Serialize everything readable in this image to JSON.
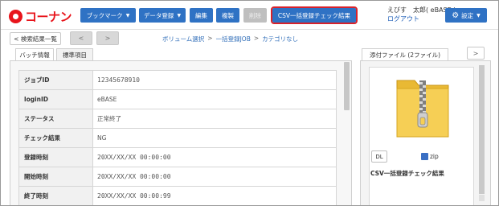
{
  "header": {
    "logo_text": "コーナン",
    "buttons": {
      "bookmark": "ブックマーク",
      "data_register": "データ登録",
      "edit": "編集",
      "copy": "複製",
      "delete": "削除",
      "csv_check": "CSV一括登録チェック結果"
    },
    "user_name": "えびす　太郎( eBASE ) ···",
    "logout": "ログアウト",
    "settings": "設定"
  },
  "subnav": {
    "back_to_results": "< 検索結果一覧",
    "prev": "<",
    "next": ">",
    "breadcrumb": [
      "ボリューム選択",
      "一括登録JOB",
      "カテゴリなし"
    ],
    "separator": ">"
  },
  "tabs": [
    "バッチ情報",
    "標準項目"
  ],
  "batch_info": [
    {
      "key": "ジョブID",
      "value": "12345678910"
    },
    {
      "key": "loginID",
      "value": "eBASE"
    },
    {
      "key": "ステータス",
      "value": "正常終了"
    },
    {
      "key": "チェック結果",
      "value": "NG"
    },
    {
      "key": "登録時刻",
      "value": "20XX/XX/XX 00:00:00"
    },
    {
      "key": "開始時刻",
      "value": "20XX/XX/XX 00:00:00"
    },
    {
      "key": "終了時刻",
      "value": "20XX/XX/XX 00:00:99"
    }
  ],
  "attachments": {
    "title": "添付ファイル (2ファイル)",
    "next": ">",
    "download": "DL",
    "file_type": "zip",
    "file_name": "CSV一括登録チェック結果"
  },
  "colors": {
    "brand_red": "#e8141b",
    "button_blue": "#2f72c4",
    "highlight_border": "#d9222a"
  }
}
